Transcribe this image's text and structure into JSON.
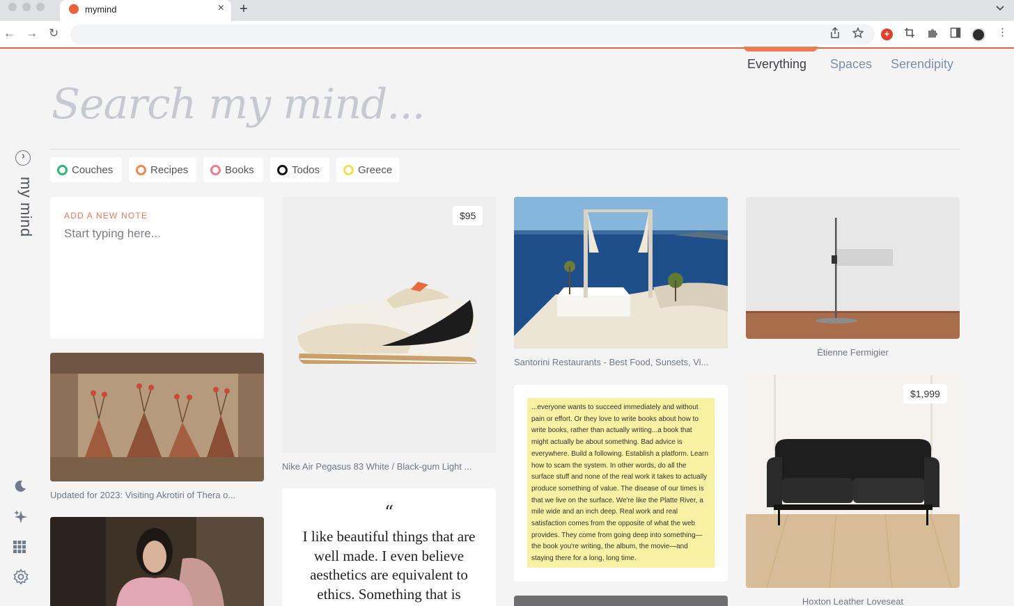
{
  "browser": {
    "tab_title": "mymind",
    "close_glyph": "×",
    "new_tab_glyph": "+",
    "back_glyph": "←",
    "forward_glyph": "→",
    "reload_glyph": "↻",
    "share_icon": "share-icon",
    "bookmark_icon": "star-icon",
    "extension_plus": "+",
    "menu_glyph": "⋮"
  },
  "nav": {
    "everything": "Everything",
    "spaces": "Spaces",
    "serendipity": "Serendipity"
  },
  "search": {
    "placeholder": "Search my mind..."
  },
  "brand": "my mind",
  "filters": [
    {
      "label": "Couches",
      "color": "#2fb67a"
    },
    {
      "label": "Recipes",
      "color": "#ee8a4f"
    },
    {
      "label": "Books",
      "color": "#ef7d8e"
    },
    {
      "label": "Todos",
      "color": "#111111"
    },
    {
      "label": "Greece",
      "color": "#f3df5a"
    }
  ],
  "note": {
    "label": "ADD A NEW NOTE",
    "placeholder": "Start typing here..."
  },
  "cards": {
    "fresco_caption": "Updated for 2023: Visiting Akrotiri of Thera o...",
    "sneaker_price": "$95",
    "sneaker_caption": "Nike Air Pegasus 83 White / Black-gum Light ...",
    "quote_mark": "“",
    "quote_text": "I like beautiful things that are well made. I even believe aesthetics are equivalent to ethics. Something that is",
    "santorini_caption": "Santorini Restaurants - Best Food, Sunsets, Vi...",
    "highlight_text": "...everyone wants to succeed immediately and without pain or effort. Or they love to write books about how to write books, rather than actually writing...a book that might actually be about something. Bad advice is everywhere. Build a following. Establish a platform. Learn how to scam the system. In other words, do all the surface stuff and none of the real work it takes to actually produce something of value. The disease of our times is that we live on the surface. We're like the Platte River, a mile wide and an inch deep. Real work and real satisfaction comes from the opposite of what the web provides. They come from going deep into something—the book you're writing, the album, the movie—and staying there for a long, long time.",
    "lamp_caption": "Étienne Fermigier",
    "loveseat_price": "$1,999",
    "loveseat_caption": "Hoxton Leather Loveseat"
  },
  "colors": {
    "accent": "#e9603f",
    "nav_inactive": "#7d90a8"
  }
}
